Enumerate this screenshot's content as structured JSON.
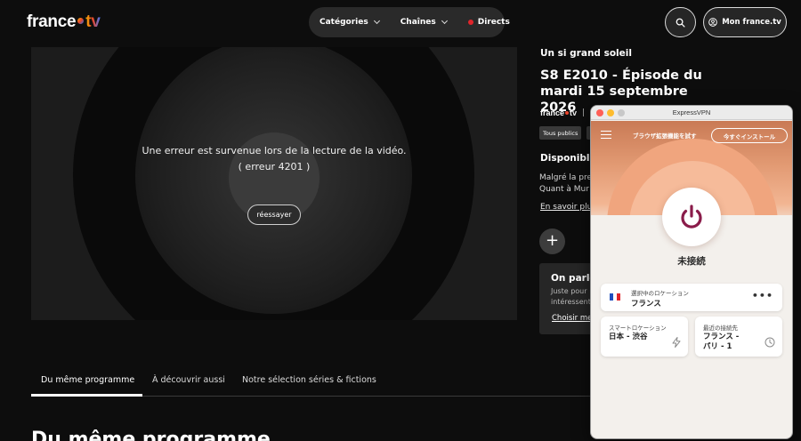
{
  "header": {
    "logo_text": "france",
    "logo_tv": "tv",
    "nav": [
      {
        "label": "Catégories"
      },
      {
        "label": "Chaînes"
      },
      {
        "label": "Directs"
      }
    ],
    "account_label": "Mon france.tv"
  },
  "player": {
    "error_line1": "Une erreur est survenue lors de la lecture de la vidéo.",
    "error_line2": "( erreur 4201 )",
    "retry_label": "réessayer"
  },
  "info": {
    "show_title": "Un si grand soleil",
    "episode_title": "S8 E2010 - Épisode du mardi 15 septembre 2026",
    "brand": "france",
    "brand_tv": "tv",
    "separator": "|",
    "badge": "Tous publics",
    "available_heading": "Disponible",
    "synopsis_line1": "Malgré la pre",
    "synopsis_line2": "Quant à Mur",
    "more_link": "En savoir plu",
    "plus_icon": "+"
  },
  "promo": {
    "heading": "On parle",
    "text_line1": "Juste pour",
    "text_line2": "intéressent",
    "link": "Choisir me"
  },
  "tabs": [
    {
      "label": "Du même programme",
      "active": true
    },
    {
      "label": "À découvrir aussi",
      "active": false
    },
    {
      "label": "Notre sélection séries & fictions",
      "active": false
    }
  ],
  "section_heading": "Du même programme",
  "vpn": {
    "window_title": "ExpressVPN",
    "ext_text": "ブラウザ拡張機能を試す",
    "install_label": "今すぐインストール",
    "status": "未接続",
    "selected_location_label": "選択中のロケーション",
    "selected_location": "フランス",
    "smart_location_label": "スマートロケーション",
    "smart_location": "日本 - 渋谷",
    "recent_label": "最近の接続先",
    "recent_line1": "フランス -",
    "recent_line2": "パリ - 1",
    "more_dots": "•••",
    "accent_color": "#8a1c4a"
  }
}
